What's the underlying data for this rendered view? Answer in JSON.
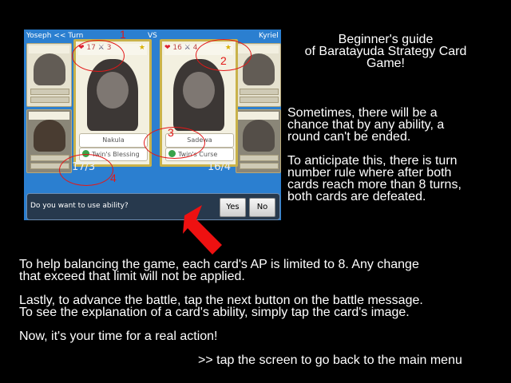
{
  "game": {
    "topbar": {
      "left": "Yoseph << Turn",
      "center": "VS",
      "right": "Kyriel"
    },
    "left_card": {
      "name": "Nakula",
      "ability": "Twin's Blessing",
      "hp": "17",
      "ap": "3"
    },
    "right_card": {
      "name": "Sadewa",
      "ability": "Twin's Curse",
      "hp": "16",
      "ap": "4"
    },
    "left_score": "17/3",
    "right_score": "16/4",
    "message": "Do you want to use ability?",
    "yes_label": "Yes",
    "no_label": "No",
    "markers": [
      "1",
      "2",
      "3",
      "4"
    ]
  },
  "guide": {
    "title_line1": "Beginner's guide",
    "title_line2": "of Baratayuda Strategy Card",
    "title_line3": "Game!",
    "p1_l1": "Sometimes, there will be a",
    "p1_l2": "chance that by any ability, a",
    "p1_l3": "round can't be ended.",
    "p2_l1": "To anticipate this, there is turn",
    "p2_l2": "number rule where after both",
    "p2_l3": "cards reach more than 8 turns,",
    "p2_l4": "both cards are defeated.",
    "p3_l1": "To help balancing the game, each card's AP is limited to 8. Any change",
    "p3_l2": "that exceed that limit will not be applied.",
    "p4_l1": "Lastly, to advance the battle, tap the next button on the battle message.",
    "p4_l2": "To see the explanation of a card's ability, simply tap the card's image.",
    "p5": "Now, it's your time for a real action!",
    "back_hint": ">> tap the screen to go back to the main menu"
  },
  "colors": {
    "highlight": "#e21818",
    "panel": "#2b7fd0",
    "gold": "#c9b24a"
  }
}
